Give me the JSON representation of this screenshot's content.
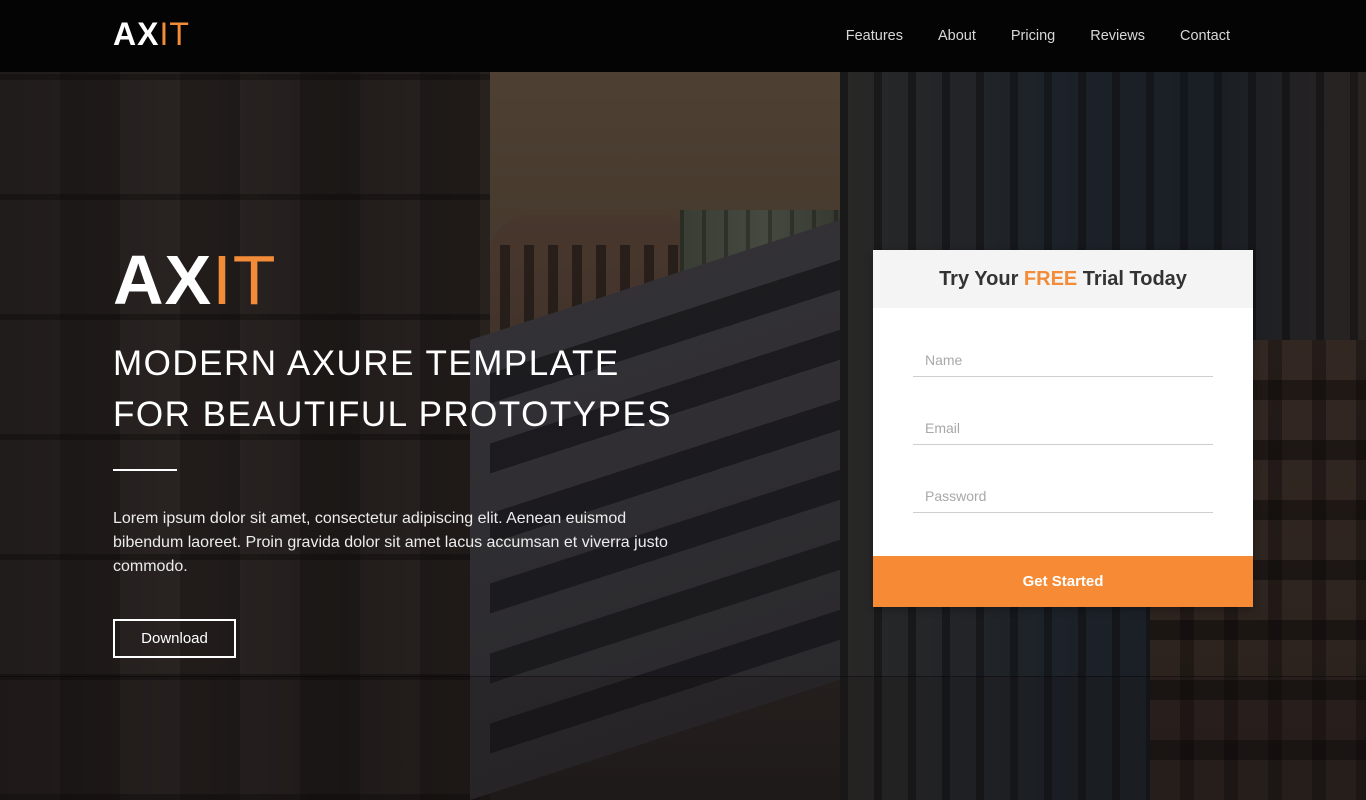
{
  "brand": {
    "logo_main": "AX",
    "logo_accent": "IT"
  },
  "nav": {
    "items": [
      {
        "label": "Features"
      },
      {
        "label": "About"
      },
      {
        "label": "Pricing"
      },
      {
        "label": "Reviews"
      },
      {
        "label": "Contact"
      }
    ]
  },
  "hero": {
    "logo_main": "AX",
    "logo_accent": "IT",
    "title_line1": "MODERN AXURE TEMPLATE",
    "title_line2": "FOR BEAUTIFUL PROTOTYPES",
    "body": "Lorem ipsum dolor sit amet, consectetur adipiscing elit. Aenean euismod bibendum laoreet. Proin gravida dolor sit amet lacus accumsan et viverra justo commodo.",
    "download_label": "Download"
  },
  "form": {
    "title_pre": "Try Your ",
    "title_highlight": "FREE",
    "title_post": " Trial Today",
    "name_placeholder": "Name",
    "email_placeholder": "Email",
    "password_placeholder": "Password",
    "submit_label": "Get Started"
  },
  "colors": {
    "accent": "#f28c38",
    "button": "#f78a34",
    "header_bg": "#040404"
  }
}
